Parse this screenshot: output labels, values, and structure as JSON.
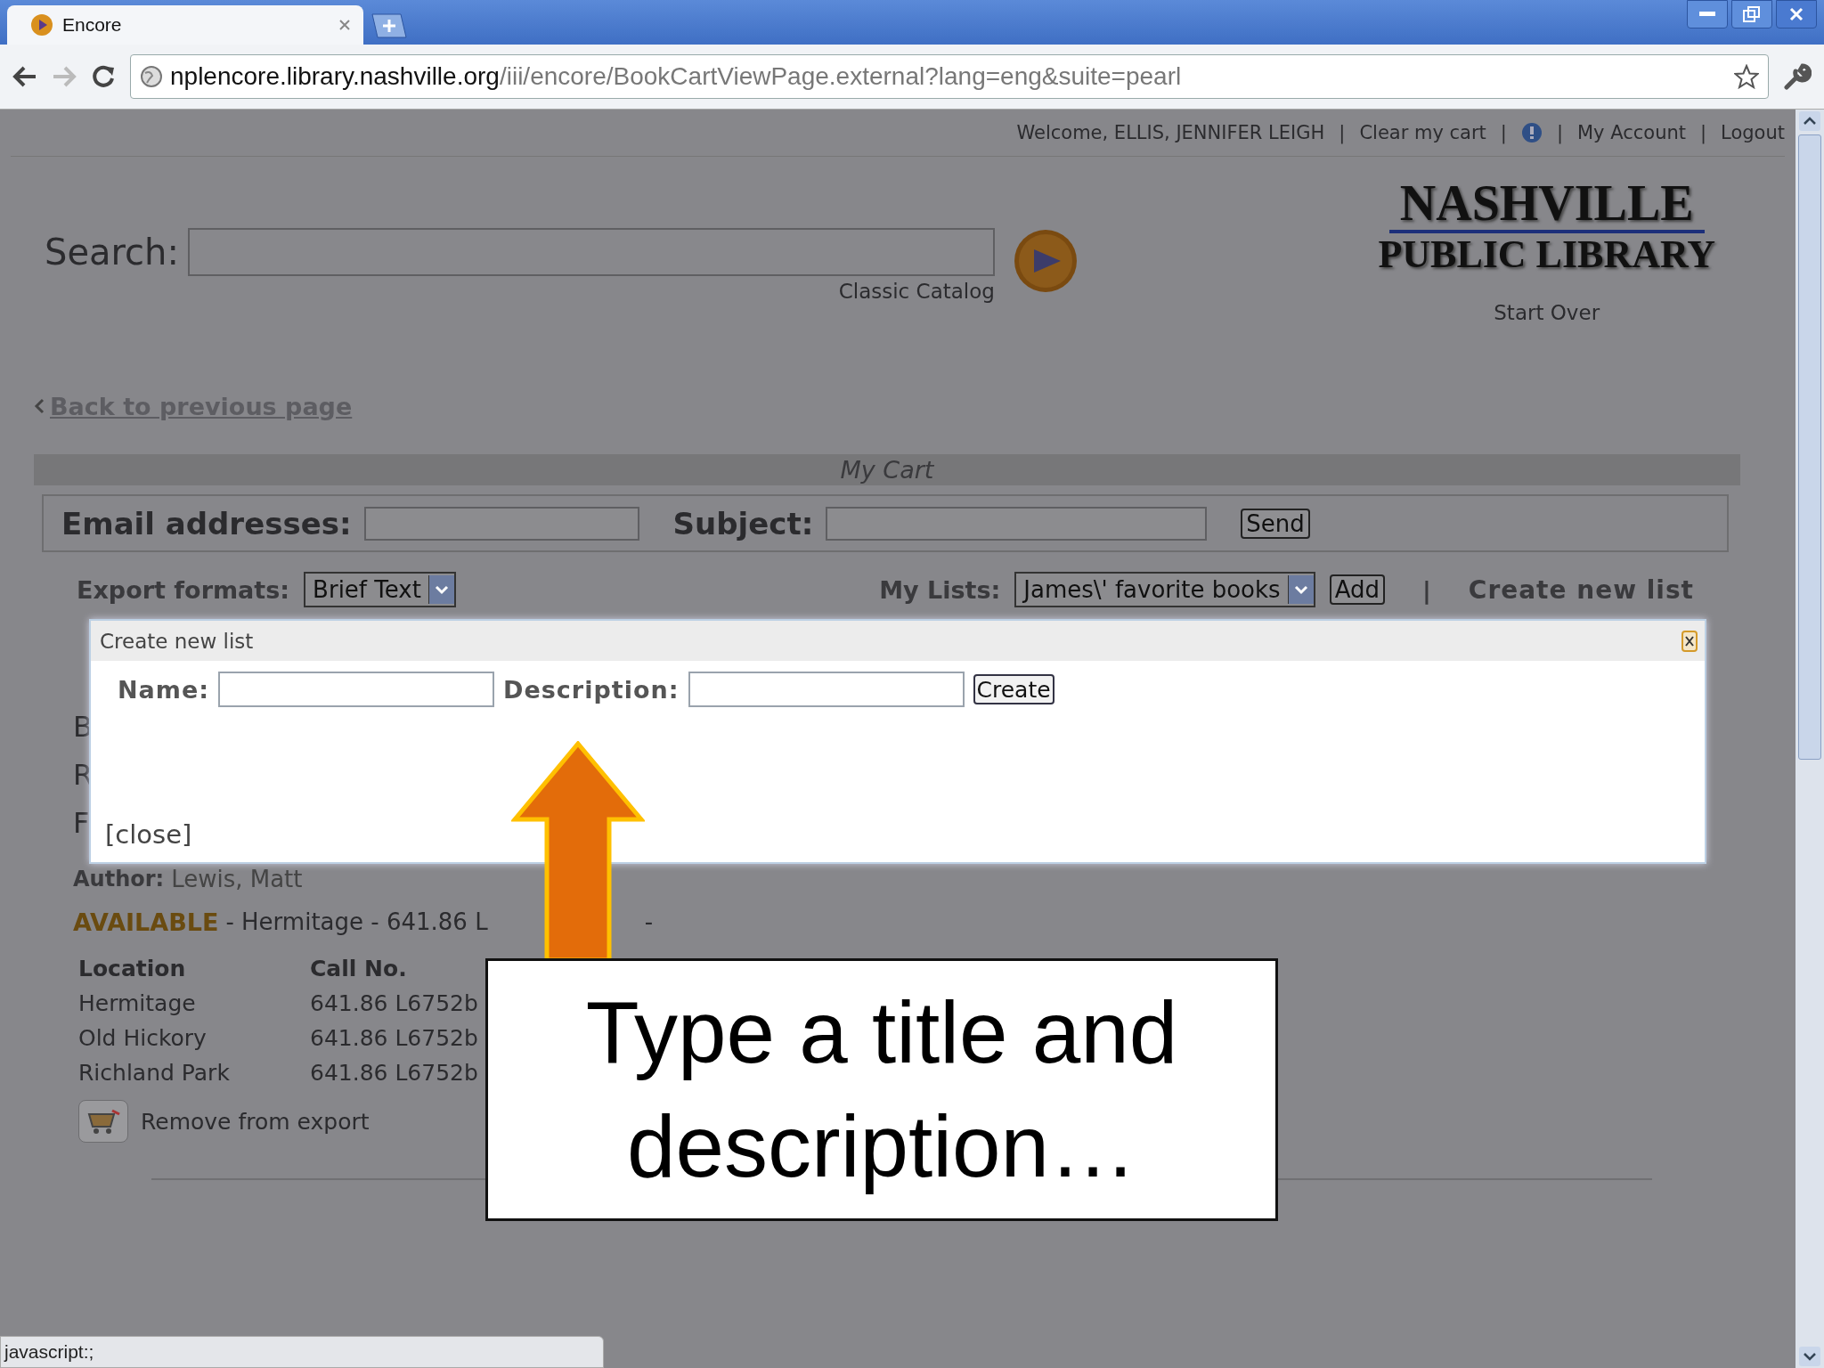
{
  "browser": {
    "tab": {
      "title": "Encore",
      "selected": true
    },
    "address": {
      "host": "nplencore.library.nashville.org",
      "path": "/iii/encore/BookCartViewPage.external?lang=eng&suite=pearl"
    }
  },
  "top_bar": [
    {
      "kind": "text",
      "text": "Welcome, ELLIS, JENNIFER LEIGH"
    },
    {
      "kind": "sep",
      "text": "|"
    },
    {
      "kind": "link",
      "text": "Clear my cart"
    },
    {
      "kind": "sep",
      "text": "|"
    },
    {
      "kind": "icon"
    },
    {
      "kind": "sep",
      "text": "|"
    },
    {
      "kind": "link",
      "text": "My Account"
    },
    {
      "kind": "sep",
      "text": "|"
    },
    {
      "kind": "link",
      "text": "Logout"
    }
  ],
  "search": {
    "label": "Search:",
    "classic": "Classic Catalog"
  },
  "logo": {
    "line1": "NASHVILLE",
    "line2": "PUBLIC LIBRARY"
  },
  "start_over": "Start Over",
  "back_link": "Back to previous page",
  "cart": {
    "title": "My Cart",
    "email_label": "Email addresses:",
    "subject_label": "Subject:",
    "send": "Send",
    "export_label": "Export formats:",
    "export_value": "Brief Text",
    "lists_label": "My Lists:",
    "lists_value": "James\\' favorite books",
    "add": "Add",
    "sep": "|",
    "create_link": "Create new list"
  },
  "dialog": {
    "title": "Create new list",
    "name_label": "Name:",
    "description_label": "Description:",
    "create": "Create",
    "close": "[close]"
  },
  "item": {
    "cut_lines": [
      "B",
      "R",
      "F"
    ],
    "author_label": "Author:",
    "author": "Lewis, Matt",
    "status": "AVAILABLE",
    "status_rest": "- Hermitage - 641.86 L",
    "status_tail": "-",
    "columns": [
      "Location",
      "Call No."
    ],
    "rows": [
      [
        "Hermitage",
        "641.86 L6752b"
      ],
      [
        "Old Hickory",
        "641.86 L6752b"
      ],
      [
        "Richland Park",
        "641.86 L6752b"
      ]
    ],
    "remove": "Remove from export"
  },
  "callout": {
    "text": "Type a title and description…"
  },
  "status_bar": "javascript:;"
}
